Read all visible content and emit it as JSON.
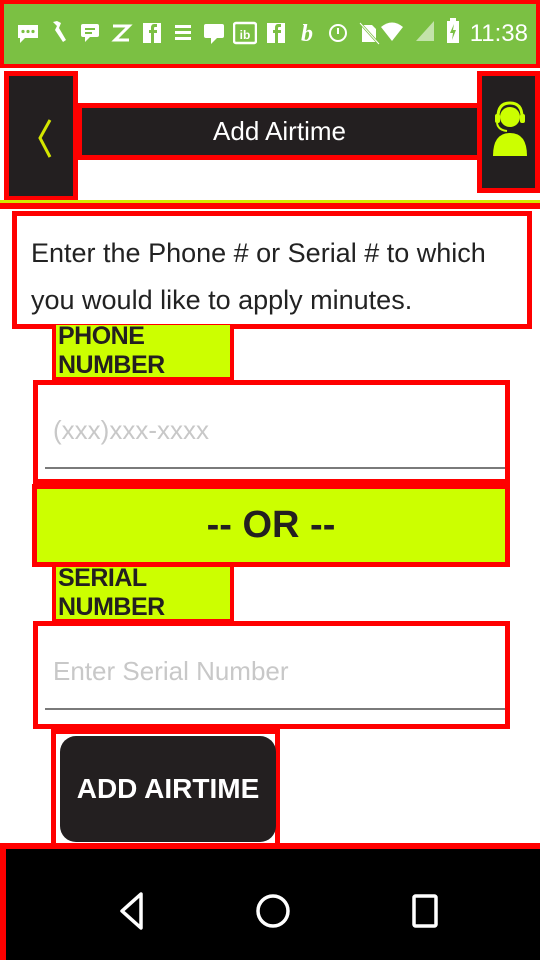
{
  "status_bar": {
    "time": "11:38",
    "notification_icons": [
      "chat-icon",
      "wrench-icon",
      "message-icon",
      "zedge-icon",
      "facebook-icon",
      "news-icon",
      "speech-icon",
      "ib-icon",
      "facebook-icon",
      "bold-b-icon",
      "alarm-icon",
      "no-sim-icon"
    ],
    "system_icons": [
      "wifi-icon",
      "signal-icon",
      "battery-icon"
    ]
  },
  "header": {
    "title": "Add Airtime",
    "back_icon": "chevron-left-icon",
    "support_icon": "customer-support-icon"
  },
  "instructions": "Enter the Phone # or Serial # to which you would like to apply minutes.",
  "phone": {
    "label": "PHONE NUMBER",
    "placeholder": "(xxx)xxx-xxxx",
    "value": ""
  },
  "separator": "-- OR --",
  "serial": {
    "label": "SERIAL NUMBER",
    "placeholder": "Enter Serial Number",
    "value": ""
  },
  "submit_label": "ADD AIRTIME",
  "nav": {
    "back": "back-icon",
    "home": "home-icon",
    "recents": "recents-icon"
  },
  "colors": {
    "accent": "#ccff00",
    "dark": "#231f20",
    "highlight_border": "#ff0000",
    "status_bar": "#7bc043"
  }
}
